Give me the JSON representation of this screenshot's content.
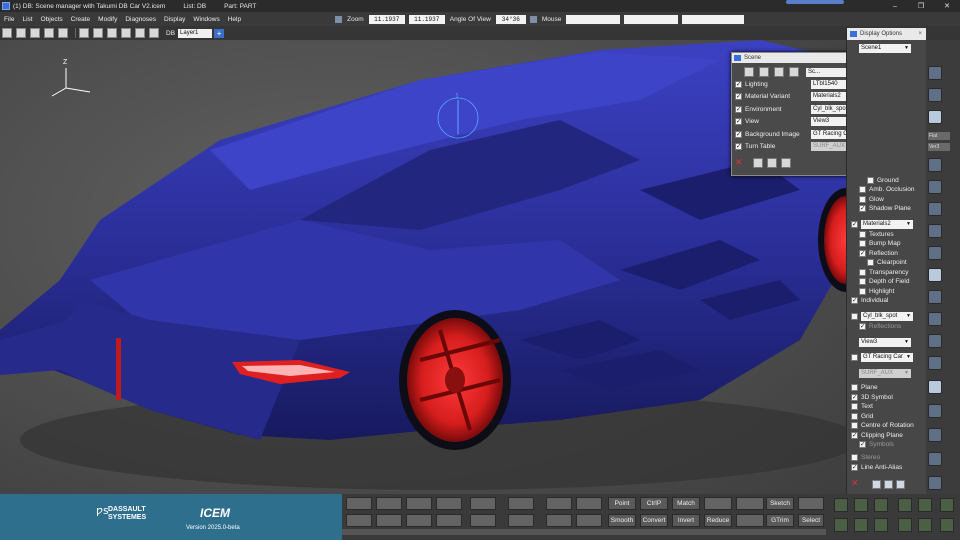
{
  "window": {
    "title": "(1) DB: Scene manager with Takumi DB Car V2.icem",
    "list": "List: DB",
    "part": "Part: PART",
    "controls": [
      "–",
      "❐",
      "✕"
    ]
  },
  "menu": {
    "items": [
      "File",
      "List",
      "Objects",
      "Create",
      "Modify",
      "Diagnoses",
      "Display",
      "Windows",
      "Help"
    ],
    "zoom_label": "Zoom",
    "zoom_value_1": "11.1937",
    "zoom_value_2": "11.1937",
    "angle_label": "Angle Of View",
    "angle_value": "34°36",
    "mouse_label": "Mouse"
  },
  "toolbar": {
    "db_label": "DB",
    "layer_value": "Layer1",
    "add_label": "+"
  },
  "viewport": {
    "axis_z": "Z",
    "marker_label": "1"
  },
  "scene_dialog": {
    "title": "Scene",
    "close": "×",
    "scene_select": "Sc...",
    "rows": [
      {
        "label": "Lighting",
        "value": "LTbl1540",
        "checked": true
      },
      {
        "label": "Material Variant",
        "value": "Materials2",
        "checked": true
      },
      {
        "label": "Environment",
        "value": "Cyl_blk_spot",
        "checked": true
      },
      {
        "label": "View",
        "value": "View3",
        "checked": true
      },
      {
        "label": "Background Image",
        "value": "GT Racing Car",
        "checked": true
      },
      {
        "label": "Turn Table",
        "value": "SURF_AUX",
        "checked": true,
        "disabled": true
      }
    ],
    "cancel": "✕"
  },
  "display_options": {
    "title": "Display Options",
    "close": "×",
    "scene_value": "Scene1",
    "ground": "Ground",
    "amb_occlusion": "Amb. Occlusion",
    "glow": "Glow",
    "shadow_plane": "Shadow Plane",
    "materials_value": "Materials2",
    "textures": "Textures",
    "bump_map": "Bump Map",
    "reflection": "Reflection",
    "clearpoint": "Clearpoint",
    "transparency": "Transparency",
    "depth_of_field": "Depth of Field",
    "highlight": "Highlight",
    "individual": "Individual",
    "env_value": "Cyl_blk_spot",
    "reflections": "Reflections",
    "view_value": "View3",
    "bg_value": "GT Racing Car",
    "surf_value": "SURF_AUX",
    "plane": "Plane",
    "symbol_3d": "3D Symbol",
    "text": "Text",
    "grid": "Grid",
    "centre_rotation": "Centre of Rotation",
    "clipping_plane": "Clipping Plane",
    "symbols": "Symbols",
    "stereo": "Stereo",
    "line_antialias": "Line Anti-Alias",
    "cancel": "✕"
  },
  "right_column": {
    "tag1": "Flat",
    "tag2": "Ver3"
  },
  "brand": {
    "ds_logo": "ƿs",
    "ds_line1": "DASSAULT",
    "ds_line2": "SYSTEMES",
    "product": "ICEM",
    "version": "Version 2025.0-beta"
  },
  "bottom_buttons": {
    "point": "Point",
    "ctrlp": "CtrlP",
    "match": "Match",
    "sketch": "Sketch",
    "smooth": "Smooth",
    "convert": "Convert",
    "invert": "Invert",
    "reduce": "Reduce",
    "gtrim": "GTrim",
    "select": "Select"
  },
  "colors": {
    "car_body": "#2b2f9a",
    "rim": "#d61d1d",
    "panel_bg": "#474747",
    "brand_bg": "#2f6f8e"
  }
}
